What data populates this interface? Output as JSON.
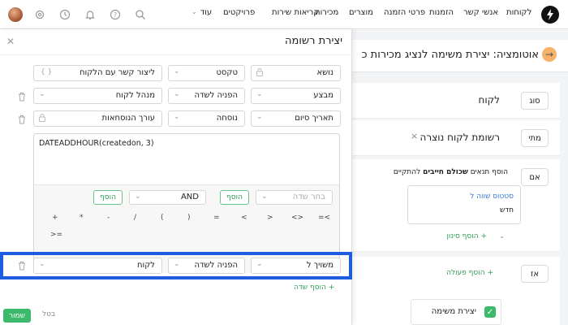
{
  "nav": {
    "items": [
      "לקוחות",
      "אנשי קשר",
      "הזמנות",
      "פרטי הזמנה",
      "מוצרים",
      "מכירות",
      "קריאות שירות",
      "פרויקטים"
    ],
    "more_label": "עוד"
  },
  "page": {
    "title": "אוטומציה: יצירת משימה לנציג מכירות כ",
    "rows": {
      "type": {
        "pill": "סוג",
        "value": "לקוח"
      },
      "when": {
        "pill": "מתי",
        "value": "רשומת לקוח נוצרה"
      },
      "if": {
        "pill": "אם",
        "prefix": "הוסף תנאים",
        "bold": "שכולם חייבים",
        "suffix": "להתקיים",
        "condition_field": "סטטוס שווה ל",
        "condition_value": "חדש",
        "add_filter": "הוסף סינון"
      },
      "then": {
        "pill": "אז",
        "add_action": "הוסף פעולה",
        "task_label": "יצירת משימה"
      }
    }
  },
  "panel": {
    "title": "יצירת רשומה",
    "rows": [
      {
        "field": "נושא",
        "type": "טקסט",
        "value": "ליצור קשר עם הלקוח"
      },
      {
        "field": "מבצע",
        "type": "הפניה לשדה",
        "value": "מנהל לקוח"
      },
      {
        "field": "תאריך סיום",
        "type": "נוסחה",
        "value": "עורך הנוסחאות"
      }
    ],
    "formula": "DATEADDHOUR(createdon, 3)",
    "formula_tools": {
      "add_label": "הוסף",
      "field_placeholder": "בחר שדה",
      "logic_value": "AND",
      "operators": [
        "=<",
        "<>",
        ">",
        "<",
        "=",
        ")",
        "(",
        "/",
        "-",
        "*",
        "+",
        ">="
      ]
    },
    "highlighted_row": {
      "field": "משויך ל",
      "type": "הפניה לשדה",
      "value": "לקוח"
    },
    "add_field": "הוסף שדה",
    "save_label": "שמור",
    "cancel_label": "בטל"
  },
  "colors": {
    "accent_green": "#3cb96a",
    "highlight_blue": "#1e5de0"
  }
}
